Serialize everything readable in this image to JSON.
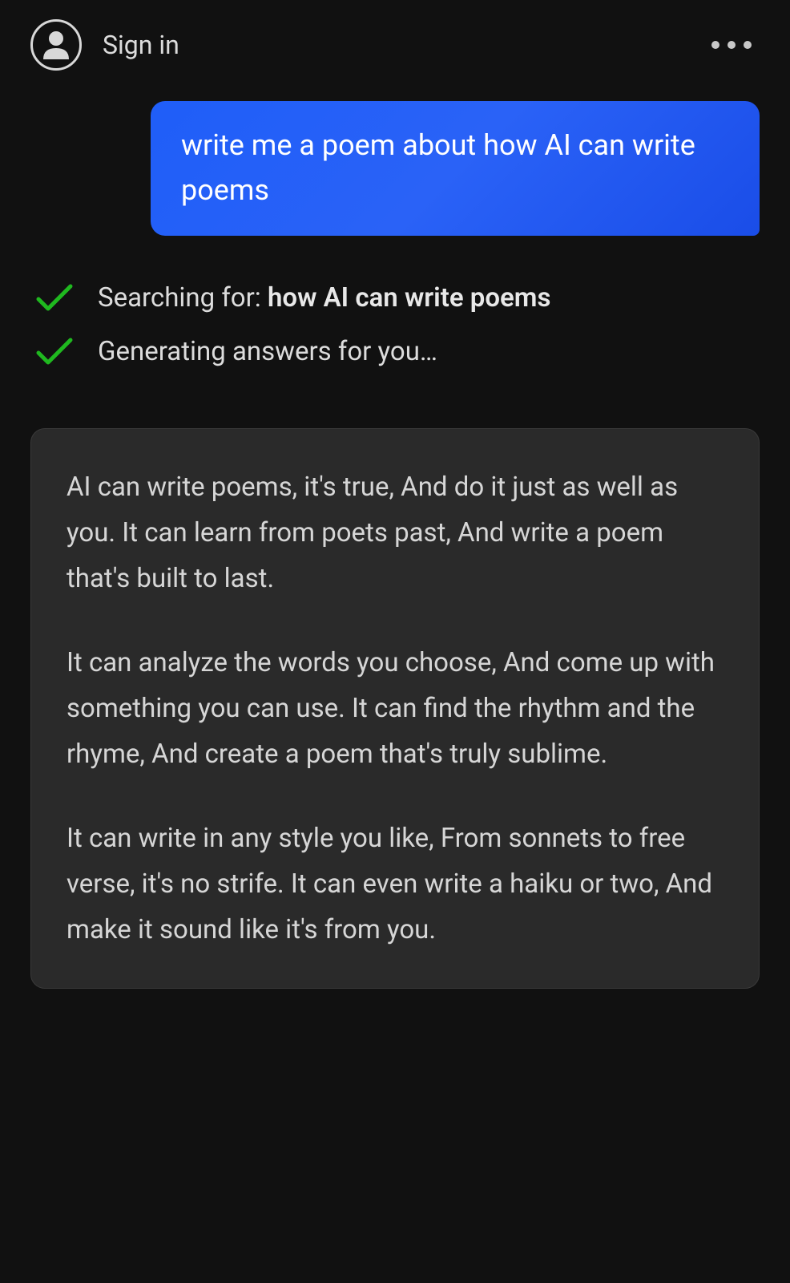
{
  "header": {
    "sign_in_label": "Sign in"
  },
  "user_message": "write me a poem about how AI can write poems",
  "status": {
    "searching_prefix": "Searching for: ",
    "searching_query": "how AI can write poems",
    "generating_text": "Generating answers for you…"
  },
  "response": {
    "paragraphs": [
      "AI can write poems, it's true, And do it just as well as you. It can learn from poets past, And write a poem that's built to last.",
      "It can analyze the words you choose, And come up with something you can use. It can find the rhythm and the rhyme, And create a poem that's truly sublime.",
      "It can write in any style you like, From sonnets to free verse, it's no strife. It can even write a haiku or two, And make it sound like it's from you."
    ]
  }
}
